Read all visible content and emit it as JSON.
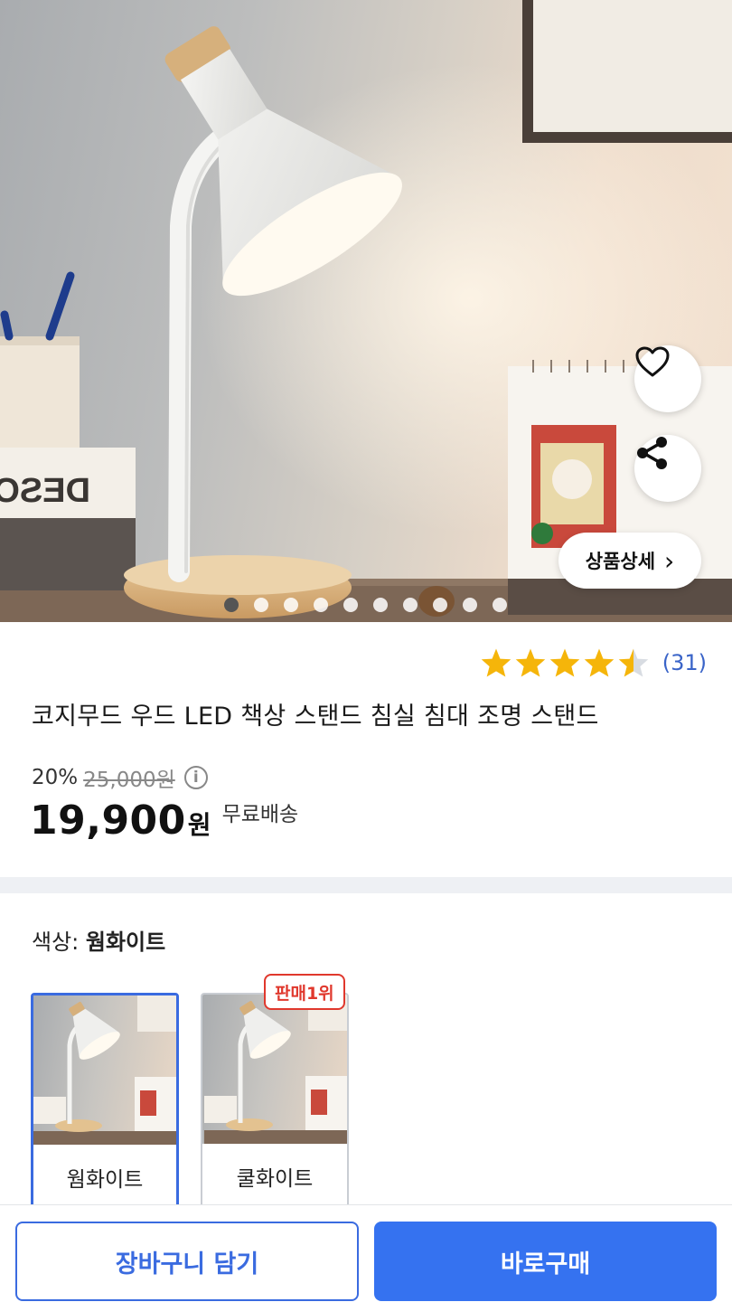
{
  "hero": {
    "image": "desk-lamp-product-photo",
    "book_text": "DESO",
    "detail_button_label": "상품상세",
    "detail_chevron": "›",
    "slide_count": 10,
    "active_slide": 1
  },
  "rating": {
    "stars": 4.5,
    "count_text": "(31)"
  },
  "product": {
    "title": "코지무드 우드 LED 책상 스탠드 침실 침대 조명 스탠드",
    "discount_rate": "20%",
    "original_price": "25,000원",
    "info_icon": "i",
    "price": "19,900",
    "currency": "원",
    "shipping": "무료배송"
  },
  "options": {
    "label_prefix": "색상: ",
    "selected_value": "웜화이트",
    "items": [
      {
        "name": "웜화이트",
        "selected": true
      },
      {
        "name": "쿨화이트",
        "selected": false,
        "badge": "판매1위"
      }
    ]
  },
  "actions": {
    "cart_label": "장바구니 담기",
    "buy_label": "바로구매"
  },
  "colors": {
    "accent_blue": "#3572f0",
    "star_yellow": "#f5b50a",
    "badge_red": "#e0382d",
    "rating_blue": "#3a64c8"
  }
}
